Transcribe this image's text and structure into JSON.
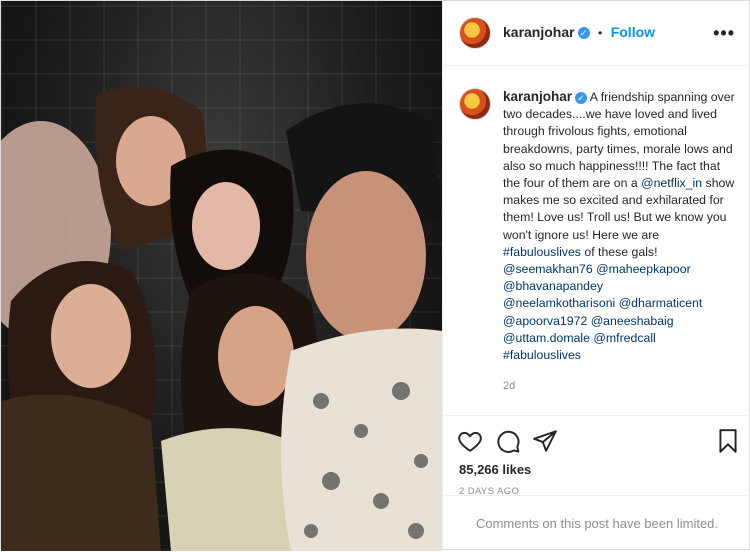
{
  "post": {
    "username": "karanjohar",
    "follow_label": "Follow",
    "dot": "•",
    "more_label": "•••",
    "verified_mark": "✓",
    "caption_lines": [
      "A friendship spanning",
      "over two decades....we have loved and",
      "lived through frivolous fights,",
      "emotional breakdowns, party times,",
      "morale lows and also so much",
      "happiness!!!! The fact that the four of",
      "them are on a ",
      "@netflix_in",
      " show makes",
      "me so excited and exhilarated for",
      "them! Love us! Troll us! But we know",
      "you won't ignore us! Here we are",
      "#fabulouslives",
      " of these gals!",
      "@seemakhan76",
      "@maheepkapoor",
      "@bhavanapandey",
      "@neelamkotharisoni",
      "@dharmaticent",
      "@apoorva1972",
      "@aneeshabaig",
      "@uttam.domale",
      "@mfredcall",
      "#fabulouslives"
    ],
    "caption_time": "2d",
    "likes": "85,266 likes",
    "time_ago": "2 DAYS AGO",
    "comments_limited": "Comments on this post have been limited."
  },
  "icons": {
    "like": "heart-icon",
    "comment": "comment-icon",
    "share": "paper-plane-icon",
    "save": "bookmark-icon"
  },
  "colors": {
    "link": "#00376b",
    "follow": "#0095f6",
    "verified": "#3897f0",
    "muted": "#8e8e8e"
  }
}
